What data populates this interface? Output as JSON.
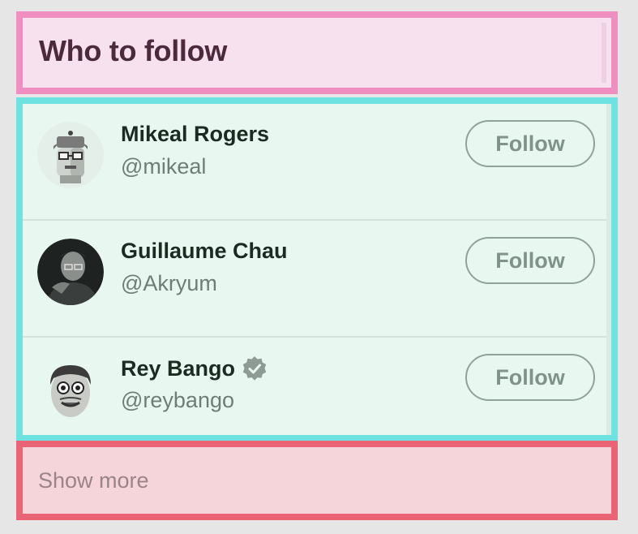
{
  "widget": {
    "title": "Who to follow",
    "show_more": "Show more"
  },
  "suggestions": [
    {
      "name": "Mikeal Rogers",
      "handle": "@mikeal",
      "verified": false,
      "button": "Follow"
    },
    {
      "name": "Guillaume Chau",
      "handle": "@Akryum",
      "verified": false,
      "button": "Follow"
    },
    {
      "name": "Rey Bango",
      "handle": "@reybango",
      "verified": true,
      "button": "Follow"
    }
  ],
  "colors": {
    "header_border": "#ef8fbf",
    "list_border": "#6de2e1",
    "footer_border": "#ea6476"
  }
}
